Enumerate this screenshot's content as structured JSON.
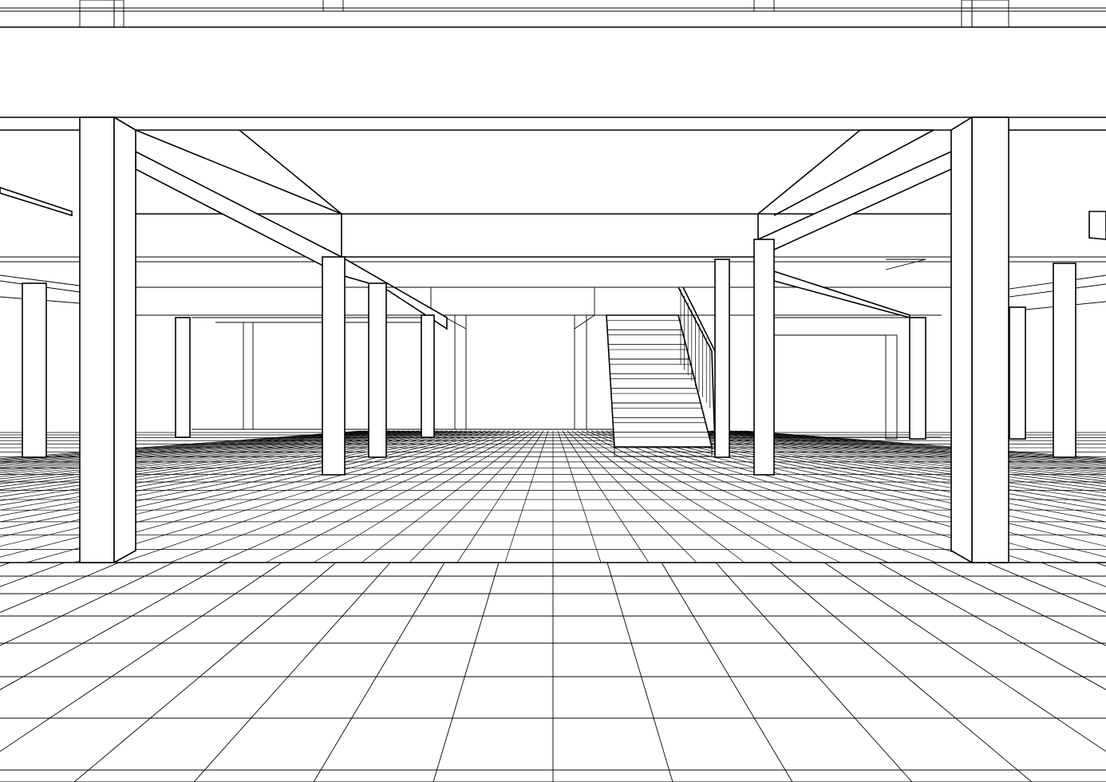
{
  "title": "",
  "drawing": {
    "style": "black line wireframe on white",
    "stroke_color": "#000000",
    "background_color": "#ffffff",
    "components": [
      "upper-floor-slab",
      "ceiling-beams",
      "columns",
      "staircase",
      "stair-handrail",
      "tiled-floor-grid",
      "back-wall"
    ]
  }
}
